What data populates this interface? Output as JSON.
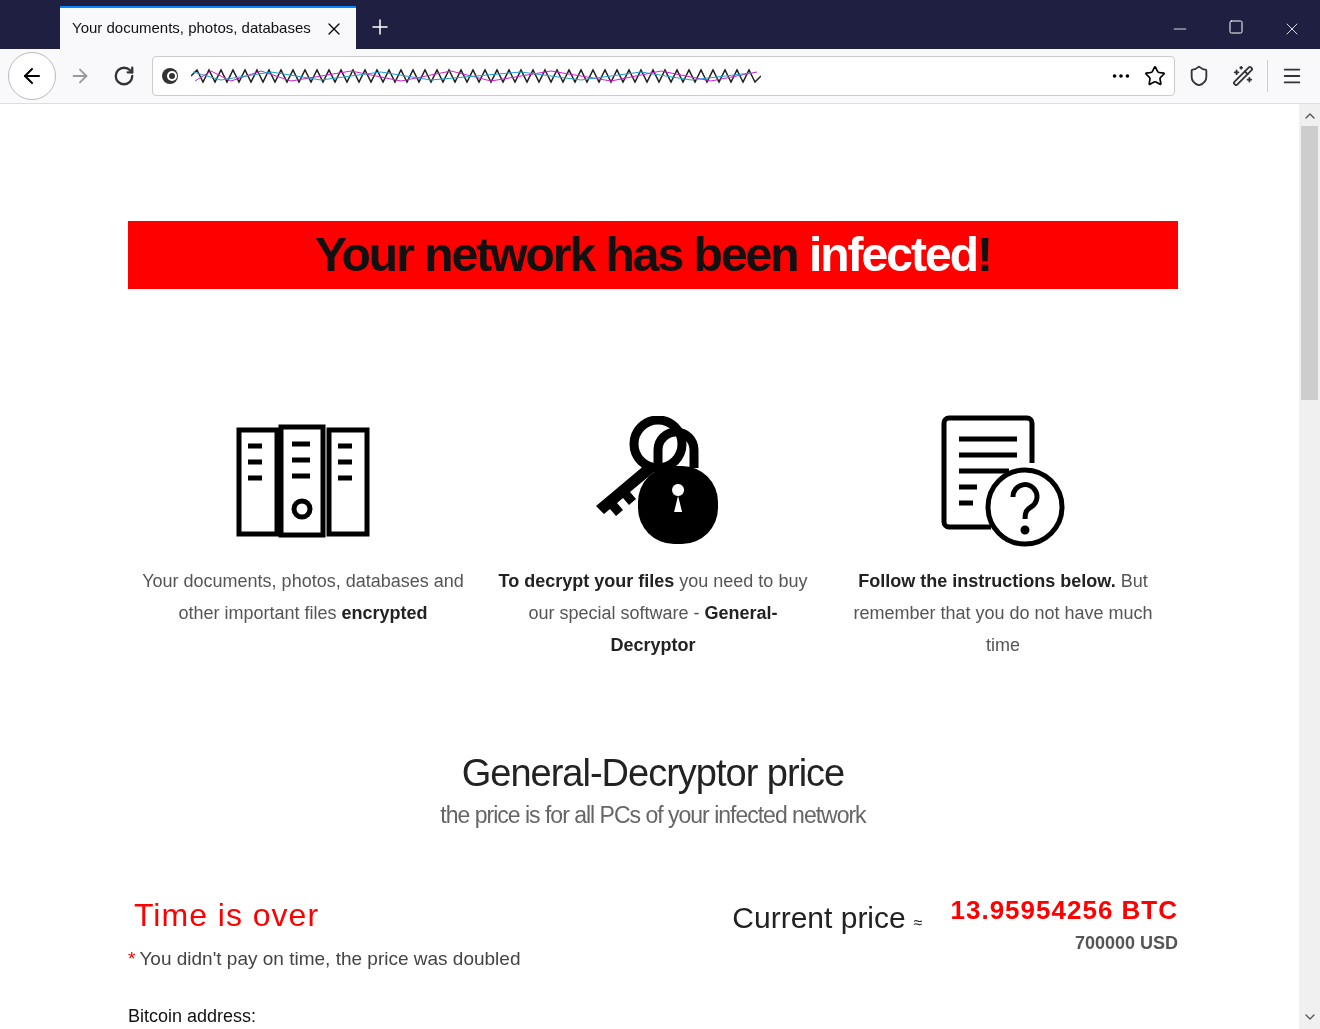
{
  "browser": {
    "tab": {
      "title": "Your documents, photos, databases",
      "selected": true
    }
  },
  "banner": {
    "before": "Your network has been ",
    "highlight": "infected",
    "after": "!"
  },
  "features": [
    {
      "kind": "files",
      "text": "Your documents, photos, databases and other important files **encrypted**"
    },
    {
      "kind": "key",
      "text": "**To decrypt your files** you need to buy our special software - **General-Decryptor**"
    },
    {
      "kind": "help",
      "text": "**Follow the instructions below.** But remember that you do not have much time"
    }
  ],
  "price": {
    "title": "General-Decryptor price",
    "subtitle": "the price is for all PCs of your infected network"
  },
  "timer": {
    "status": "Time is over",
    "note_mark": "*",
    "note": "You didn't pay on time, the price was doubled"
  },
  "current_price": {
    "label": "Current price",
    "approx": "≈",
    "btc": "13.95954256 BTC",
    "usd": "700000 USD"
  },
  "bitcoin_address": {
    "label": "Bitcoin address:"
  }
}
